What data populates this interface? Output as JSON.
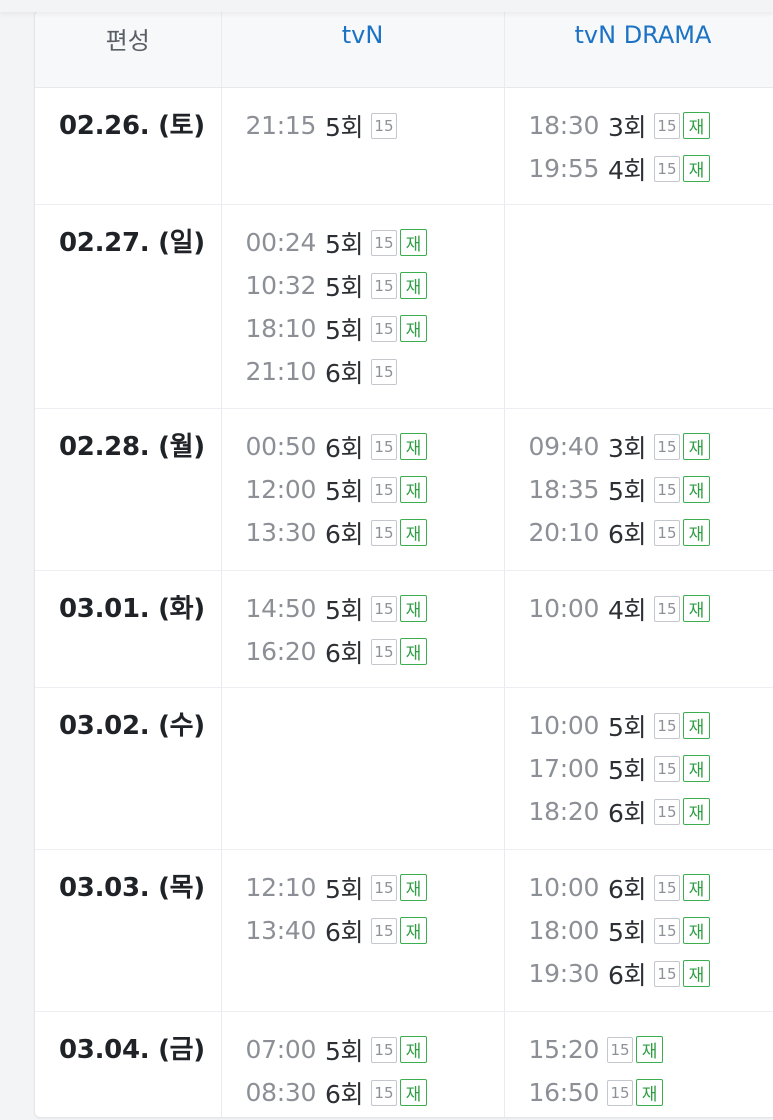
{
  "header": {
    "date_col": "편성",
    "channels": [
      "tvN",
      "tvN DRAMA"
    ]
  },
  "rows": [
    {
      "date": "02.26. (토)",
      "tvn": [
        {
          "time": "21:15",
          "ep": "5회",
          "age": "15",
          "rerun": ""
        }
      ],
      "drama": [
        {
          "time": "18:30",
          "ep": "3회",
          "age": "15",
          "rerun": "재"
        },
        {
          "time": "19:55",
          "ep": "4회",
          "age": "15",
          "rerun": "재"
        }
      ]
    },
    {
      "date": "02.27. (일)",
      "tvn": [
        {
          "time": "00:24",
          "ep": "5회",
          "age": "15",
          "rerun": "재"
        },
        {
          "time": "10:32",
          "ep": "5회",
          "age": "15",
          "rerun": "재"
        },
        {
          "time": "18:10",
          "ep": "5회",
          "age": "15",
          "rerun": "재"
        },
        {
          "time": "21:10",
          "ep": "6회",
          "age": "15",
          "rerun": ""
        }
      ],
      "drama": []
    },
    {
      "date": "02.28. (월)",
      "tvn": [
        {
          "time": "00:50",
          "ep": "6회",
          "age": "15",
          "rerun": "재"
        },
        {
          "time": "12:00",
          "ep": "5회",
          "age": "15",
          "rerun": "재"
        },
        {
          "time": "13:30",
          "ep": "6회",
          "age": "15",
          "rerun": "재"
        }
      ],
      "drama": [
        {
          "time": "09:40",
          "ep": "3회",
          "age": "15",
          "rerun": "재"
        },
        {
          "time": "18:35",
          "ep": "5회",
          "age": "15",
          "rerun": "재"
        },
        {
          "time": "20:10",
          "ep": "6회",
          "age": "15",
          "rerun": "재"
        }
      ]
    },
    {
      "date": "03.01. (화)",
      "tvn": [
        {
          "time": "14:50",
          "ep": "5회",
          "age": "15",
          "rerun": "재"
        },
        {
          "time": "16:20",
          "ep": "6회",
          "age": "15",
          "rerun": "재"
        }
      ],
      "drama": [
        {
          "time": "10:00",
          "ep": "4회",
          "age": "15",
          "rerun": "재"
        }
      ]
    },
    {
      "date": "03.02. (수)",
      "tvn": [],
      "drama": [
        {
          "time": "10:00",
          "ep": "5회",
          "age": "15",
          "rerun": "재"
        },
        {
          "time": "17:00",
          "ep": "5회",
          "age": "15",
          "rerun": "재"
        },
        {
          "time": "18:20",
          "ep": "6회",
          "age": "15",
          "rerun": "재"
        }
      ]
    },
    {
      "date": "03.03. (목)",
      "tvn": [
        {
          "time": "12:10",
          "ep": "5회",
          "age": "15",
          "rerun": "재"
        },
        {
          "time": "13:40",
          "ep": "6회",
          "age": "15",
          "rerun": "재"
        }
      ],
      "drama": [
        {
          "time": "10:00",
          "ep": "6회",
          "age": "15",
          "rerun": "재"
        },
        {
          "time": "18:00",
          "ep": "5회",
          "age": "15",
          "rerun": "재"
        },
        {
          "time": "19:30",
          "ep": "6회",
          "age": "15",
          "rerun": "재"
        }
      ]
    },
    {
      "date": "03.04. (금)",
      "tvn": [
        {
          "time": "07:00",
          "ep": "5회",
          "age": "15",
          "rerun": "재"
        },
        {
          "time": "08:30",
          "ep": "6회",
          "age": "15",
          "rerun": "재"
        }
      ],
      "drama": [
        {
          "time": "15:20",
          "ep": "",
          "age": "15",
          "rerun": "재"
        },
        {
          "time": "16:50",
          "ep": "",
          "age": "15",
          "rerun": "재"
        }
      ]
    }
  ]
}
